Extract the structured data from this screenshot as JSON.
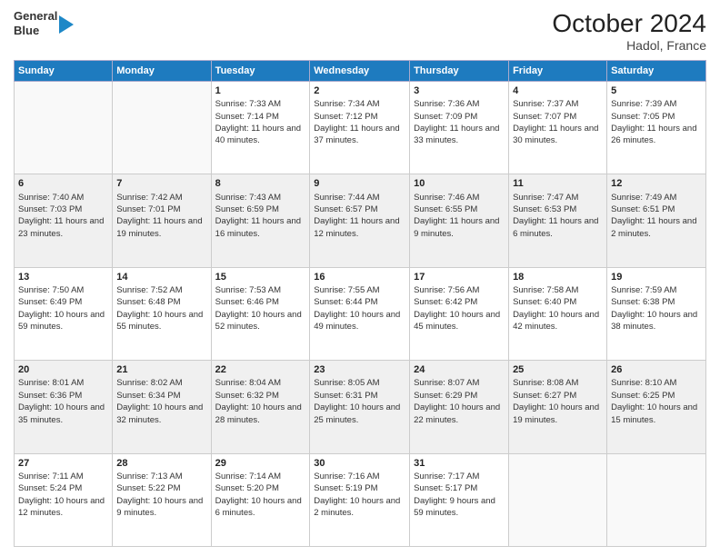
{
  "header": {
    "logo_line1": "General",
    "logo_line2": "Blue",
    "title": "October 2024",
    "subtitle": "Hadol, France"
  },
  "days_of_week": [
    "Sunday",
    "Monday",
    "Tuesday",
    "Wednesday",
    "Thursday",
    "Friday",
    "Saturday"
  ],
  "weeks": [
    [
      {
        "day": "",
        "info": ""
      },
      {
        "day": "",
        "info": ""
      },
      {
        "day": "1",
        "info": "Sunrise: 7:33 AM\nSunset: 7:14 PM\nDaylight: 11 hours and 40 minutes."
      },
      {
        "day": "2",
        "info": "Sunrise: 7:34 AM\nSunset: 7:12 PM\nDaylight: 11 hours and 37 minutes."
      },
      {
        "day": "3",
        "info": "Sunrise: 7:36 AM\nSunset: 7:09 PM\nDaylight: 11 hours and 33 minutes."
      },
      {
        "day": "4",
        "info": "Sunrise: 7:37 AM\nSunset: 7:07 PM\nDaylight: 11 hours and 30 minutes."
      },
      {
        "day": "5",
        "info": "Sunrise: 7:39 AM\nSunset: 7:05 PM\nDaylight: 11 hours and 26 minutes."
      }
    ],
    [
      {
        "day": "6",
        "info": "Sunrise: 7:40 AM\nSunset: 7:03 PM\nDaylight: 11 hours and 23 minutes."
      },
      {
        "day": "7",
        "info": "Sunrise: 7:42 AM\nSunset: 7:01 PM\nDaylight: 11 hours and 19 minutes."
      },
      {
        "day": "8",
        "info": "Sunrise: 7:43 AM\nSunset: 6:59 PM\nDaylight: 11 hours and 16 minutes."
      },
      {
        "day": "9",
        "info": "Sunrise: 7:44 AM\nSunset: 6:57 PM\nDaylight: 11 hours and 12 minutes."
      },
      {
        "day": "10",
        "info": "Sunrise: 7:46 AM\nSunset: 6:55 PM\nDaylight: 11 hours and 9 minutes."
      },
      {
        "day": "11",
        "info": "Sunrise: 7:47 AM\nSunset: 6:53 PM\nDaylight: 11 hours and 6 minutes."
      },
      {
        "day": "12",
        "info": "Sunrise: 7:49 AM\nSunset: 6:51 PM\nDaylight: 11 hours and 2 minutes."
      }
    ],
    [
      {
        "day": "13",
        "info": "Sunrise: 7:50 AM\nSunset: 6:49 PM\nDaylight: 10 hours and 59 minutes."
      },
      {
        "day": "14",
        "info": "Sunrise: 7:52 AM\nSunset: 6:48 PM\nDaylight: 10 hours and 55 minutes."
      },
      {
        "day": "15",
        "info": "Sunrise: 7:53 AM\nSunset: 6:46 PM\nDaylight: 10 hours and 52 minutes."
      },
      {
        "day": "16",
        "info": "Sunrise: 7:55 AM\nSunset: 6:44 PM\nDaylight: 10 hours and 49 minutes."
      },
      {
        "day": "17",
        "info": "Sunrise: 7:56 AM\nSunset: 6:42 PM\nDaylight: 10 hours and 45 minutes."
      },
      {
        "day": "18",
        "info": "Sunrise: 7:58 AM\nSunset: 6:40 PM\nDaylight: 10 hours and 42 minutes."
      },
      {
        "day": "19",
        "info": "Sunrise: 7:59 AM\nSunset: 6:38 PM\nDaylight: 10 hours and 38 minutes."
      }
    ],
    [
      {
        "day": "20",
        "info": "Sunrise: 8:01 AM\nSunset: 6:36 PM\nDaylight: 10 hours and 35 minutes."
      },
      {
        "day": "21",
        "info": "Sunrise: 8:02 AM\nSunset: 6:34 PM\nDaylight: 10 hours and 32 minutes."
      },
      {
        "day": "22",
        "info": "Sunrise: 8:04 AM\nSunset: 6:32 PM\nDaylight: 10 hours and 28 minutes."
      },
      {
        "day": "23",
        "info": "Sunrise: 8:05 AM\nSunset: 6:31 PM\nDaylight: 10 hours and 25 minutes."
      },
      {
        "day": "24",
        "info": "Sunrise: 8:07 AM\nSunset: 6:29 PM\nDaylight: 10 hours and 22 minutes."
      },
      {
        "day": "25",
        "info": "Sunrise: 8:08 AM\nSunset: 6:27 PM\nDaylight: 10 hours and 19 minutes."
      },
      {
        "day": "26",
        "info": "Sunrise: 8:10 AM\nSunset: 6:25 PM\nDaylight: 10 hours and 15 minutes."
      }
    ],
    [
      {
        "day": "27",
        "info": "Sunrise: 7:11 AM\nSunset: 5:24 PM\nDaylight: 10 hours and 12 minutes."
      },
      {
        "day": "28",
        "info": "Sunrise: 7:13 AM\nSunset: 5:22 PM\nDaylight: 10 hours and 9 minutes."
      },
      {
        "day": "29",
        "info": "Sunrise: 7:14 AM\nSunset: 5:20 PM\nDaylight: 10 hours and 6 minutes."
      },
      {
        "day": "30",
        "info": "Sunrise: 7:16 AM\nSunset: 5:19 PM\nDaylight: 10 hours and 2 minutes."
      },
      {
        "day": "31",
        "info": "Sunrise: 7:17 AM\nSunset: 5:17 PM\nDaylight: 9 hours and 59 minutes."
      },
      {
        "day": "",
        "info": ""
      },
      {
        "day": "",
        "info": ""
      }
    ]
  ]
}
